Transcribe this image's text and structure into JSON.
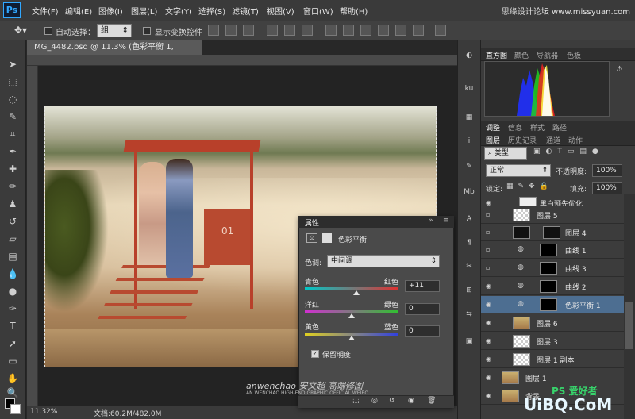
{
  "app": {
    "logo": "Ps"
  },
  "menu": [
    "文件(F)",
    "编辑(E)",
    "图像(I)",
    "图层(L)",
    "文字(Y)",
    "选择(S)",
    "滤镜(T)",
    "视图(V)",
    "窗口(W)",
    "帮助(H)"
  ],
  "watermark_top": "思缘设计论坛 www.missyuan.com",
  "options": {
    "auto_select_label": "自动选择：",
    "auto_select_value": "组",
    "show_transform_label": "显示变换控件"
  },
  "document": {
    "tab_title": "IMG_4482.psd @ 11.3% (色彩平衡 1, RGB/8) *",
    "zoom": "11.32%",
    "doc_size": "文档:60.2M/482.0M"
  },
  "panels": {
    "top_tabs": [
      "直方图",
      "颜色",
      "导航器",
      "色板"
    ],
    "mid_tabs": [
      "调整",
      "信息",
      "样式",
      "路径"
    ],
    "layer_tabs": [
      "图层",
      "历史记录",
      "通道",
      "动作"
    ],
    "layer_filter": "类型",
    "blend_mode": "正常",
    "opacity_label": "不透明度:",
    "opacity_value": "100%",
    "lock_label": "锁定:",
    "fill_label": "填充:",
    "fill_value": "100%"
  },
  "layers": [
    {
      "name": "黑白预先优化",
      "thumb": "#eee"
    },
    {
      "name": "图层 5",
      "thumb": "#ddd"
    },
    {
      "name": "图层 4",
      "thumb": "#111"
    },
    {
      "name": "曲线 1",
      "thumb": "#000"
    },
    {
      "name": "曲线 3",
      "thumb": "#000"
    },
    {
      "name": "曲线 2",
      "thumb": "#000"
    },
    {
      "name": "色彩平衡 1",
      "thumb": "#000"
    },
    {
      "name": "图层 6",
      "thumb": "#c9a06a"
    },
    {
      "name": "图层 3",
      "thumb": "#ddd"
    },
    {
      "name": "图层 1 副本",
      "thumb": "#ddd"
    },
    {
      "name": "图层 1",
      "thumb": "#c9a06a"
    },
    {
      "name": "背景",
      "thumb": "#c9a06a"
    }
  ],
  "properties": {
    "title": "属性",
    "panel_name": "色彩平衡",
    "tone_label": "色调:",
    "tone_value": "中间调",
    "sliders": [
      {
        "left": "青色",
        "right": "红色",
        "value": "+11",
        "level": 0.55,
        "left_color": "#00c8c8",
        "right_color": "#e03030"
      },
      {
        "left": "洋红",
        "right": "绿色",
        "value": "0",
        "level": 0.5,
        "left_color": "#d030d0",
        "right_color": "#30c030"
      },
      {
        "left": "黄色",
        "right": "蓝色",
        "value": "0",
        "level": 0.5,
        "left_color": "#e0d020",
        "right_color": "#3040e0"
      }
    ],
    "preserve_label": "保留明度"
  },
  "photo_text": {
    "hut_number": "01"
  },
  "watermarks": {
    "bottom": "anwenchao  安文超 高端修图",
    "bottom_sub": "AN WENCHAO  HIGH-END GRAPHIC  OFFICIAL  WEIBO",
    "corner_ps": "PS 爱好者",
    "corner_site": "UiBQ.CoM"
  }
}
